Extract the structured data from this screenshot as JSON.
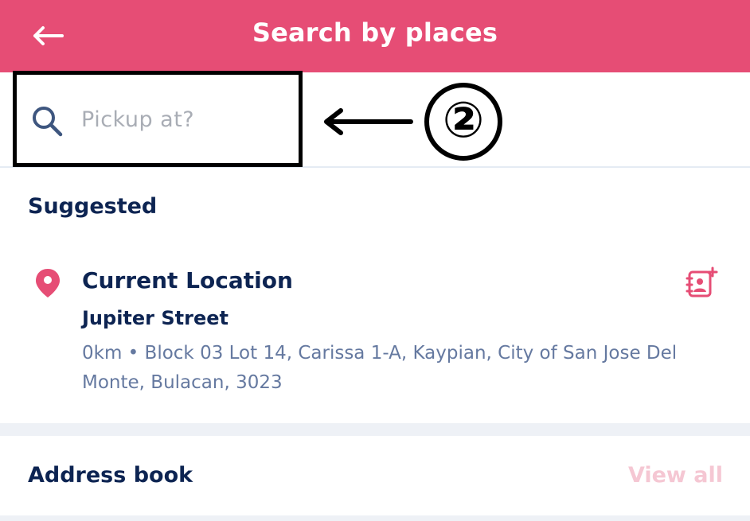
{
  "header": {
    "title": "Search by places",
    "back_icon": "arrow-left-icon",
    "background": "#e64d75"
  },
  "search": {
    "placeholder": "Pickup at?",
    "value": "",
    "icon": "search-icon"
  },
  "annotation": {
    "label": "②",
    "arrow_icon": "arrow-left-icon"
  },
  "suggested": {
    "title": "Suggested",
    "item": {
      "icon": "location-pin-icon",
      "name": "Current Location",
      "street": "Jupiter Street",
      "address": "0km • Block 03 Lot 14, Carissa 1-A, Kaypian, City of San Jose Del Monte, Bulacan, 3023",
      "action_icon": "add-contact-icon"
    }
  },
  "address_book": {
    "title": "Address book",
    "view_all": "View all"
  },
  "colors": {
    "brand": "#e64d75",
    "heading": "#0d2452",
    "muted_text": "#6579a0",
    "disabled_link": "#f5c7d3"
  }
}
